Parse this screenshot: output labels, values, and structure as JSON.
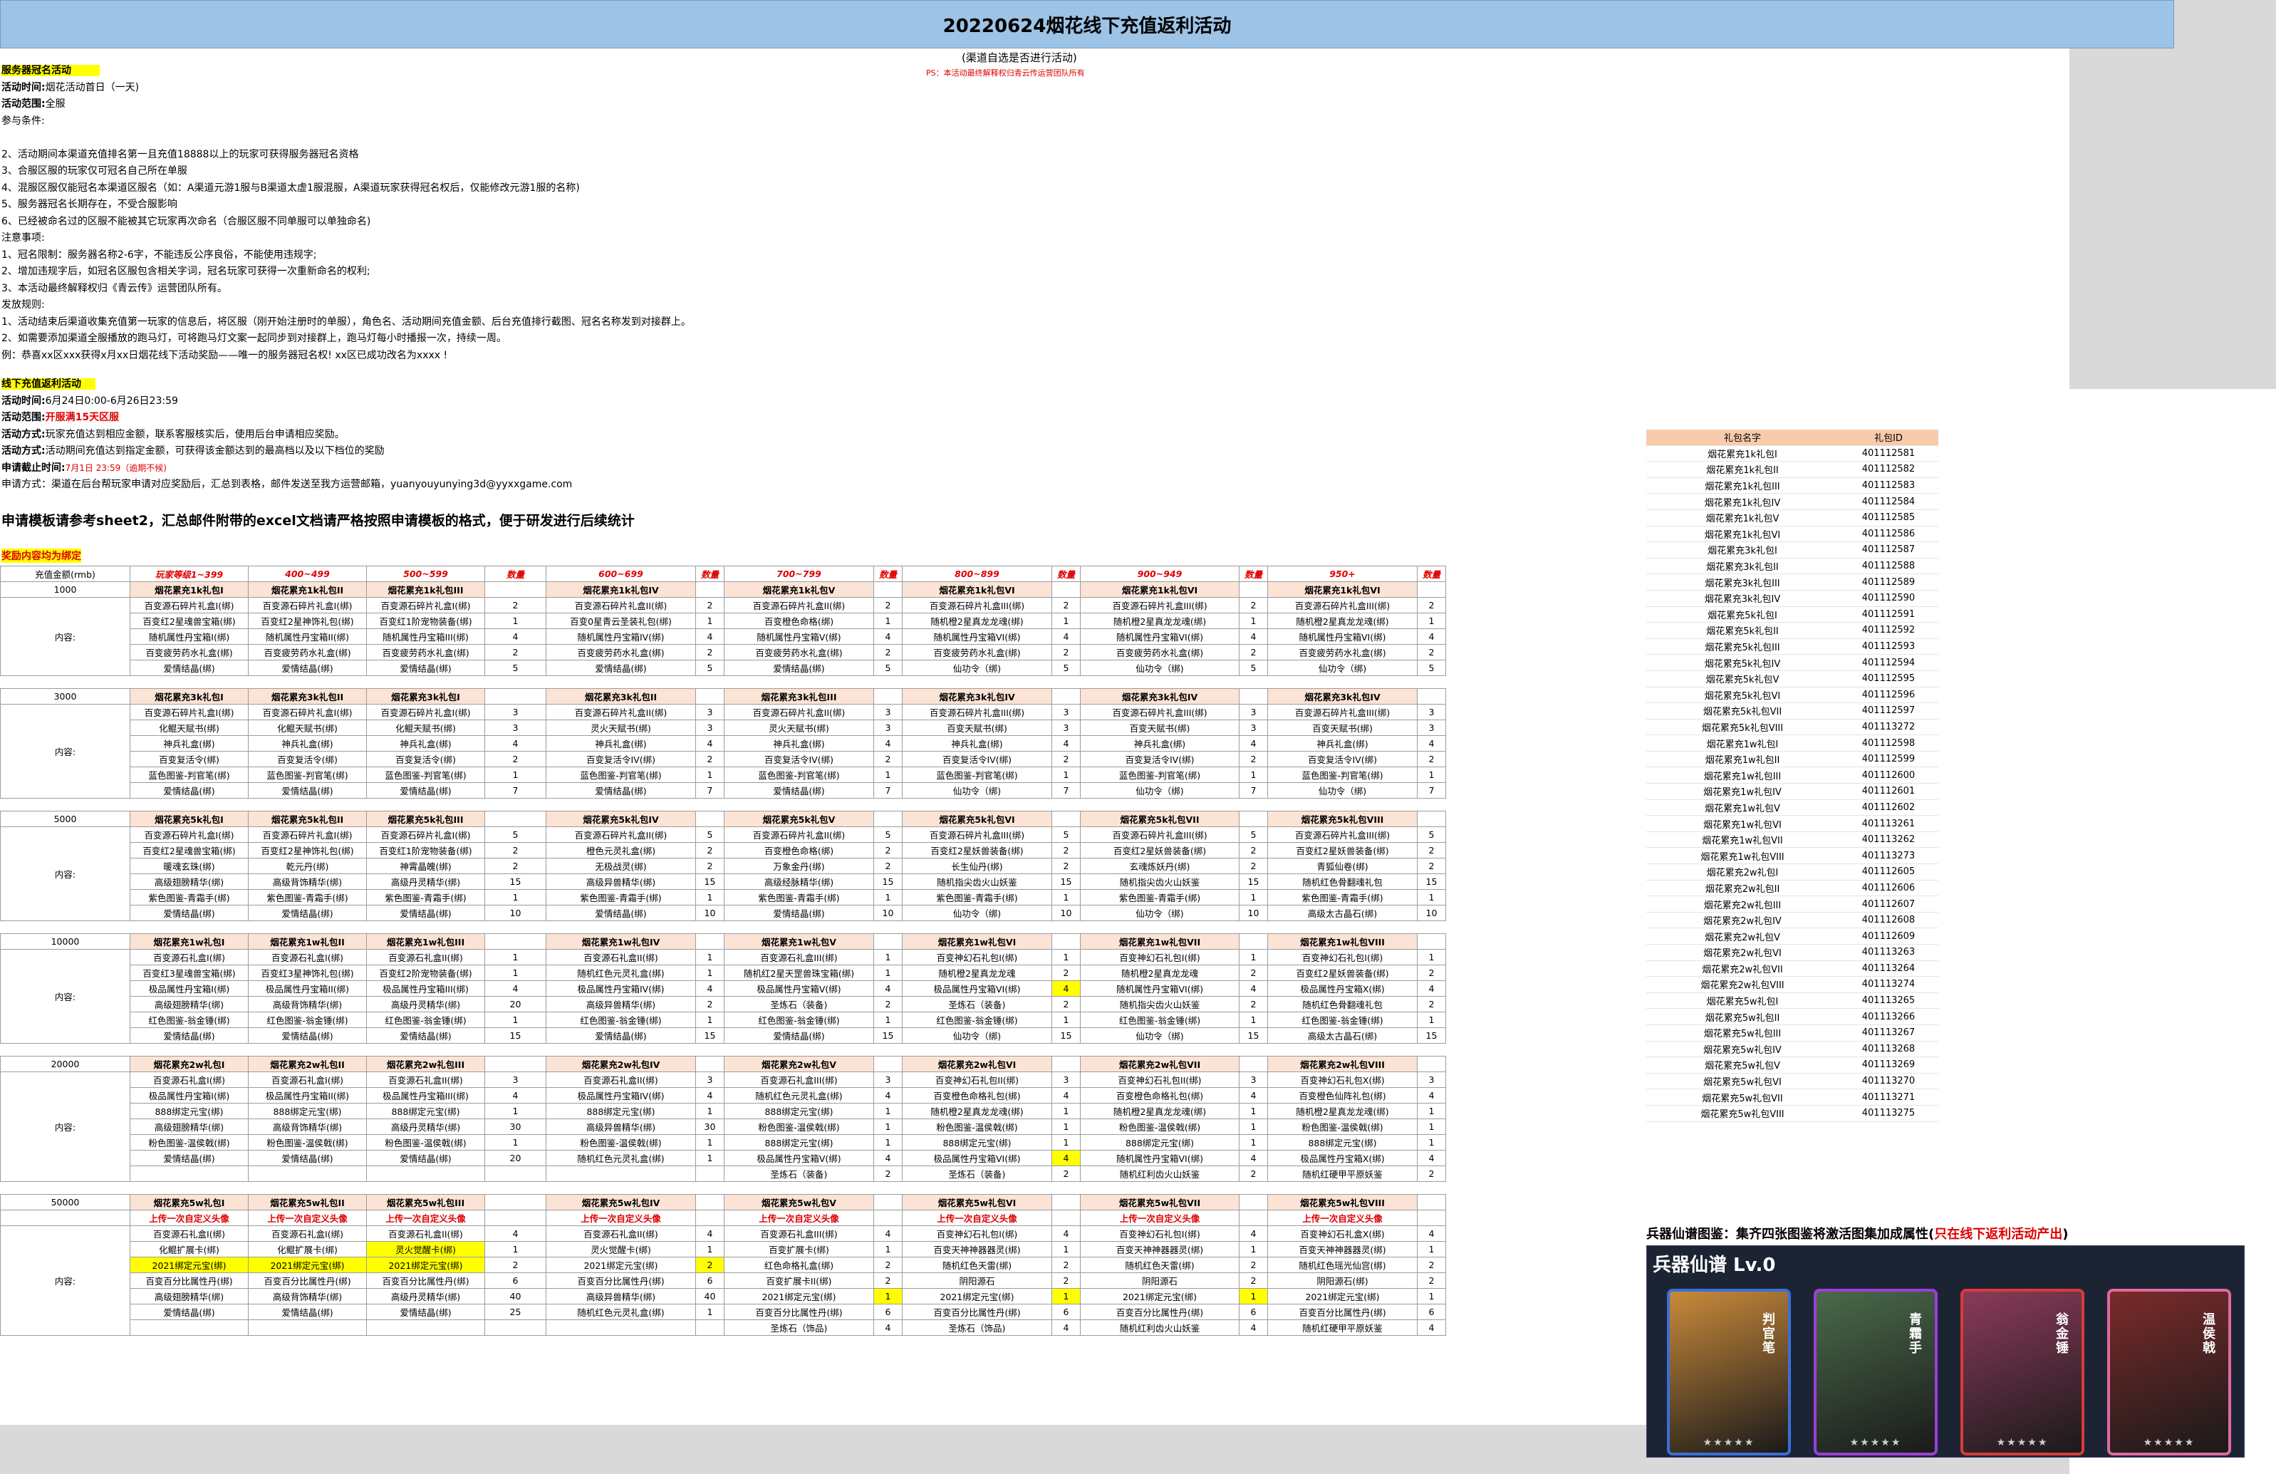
{
  "title": "20220624烟花线下充值返利活动",
  "subtitle": "(渠道自选是否进行活动)",
  "ps_note": "PS：本活动最终解释权归青云传运营团队所有",
  "section1": {
    "heading": "服务器冠名活动",
    "lines": [
      {
        "k": "活动时间:",
        "v": "烟花活动首日（一天)"
      },
      {
        "k": "活动范围:",
        "v": "全服"
      },
      {
        "k": "",
        "v": "参与条件:"
      },
      {
        "k": "",
        "v": ""
      },
      {
        "k": "",
        "v": "2、活动期间本渠道充值排名第一且充值18888以上的玩家可获得服务器冠名资格"
      },
      {
        "k": "",
        "v": "3、合服区服的玩家仅可冠名自己所在单服"
      },
      {
        "k": "",
        "v": "4、混服区服仅能冠名本渠道区服名（如：A渠道元游1服与B渠道太虚1服混服，A渠道玩家获得冠名权后，仅能修改元游1服的名称)"
      },
      {
        "k": "",
        "v": "5、服务器冠名长期存在，不受合服影响"
      },
      {
        "k": "",
        "v": "6、已经被命名过的区服不能被其它玩家再次命名（合服区服不同单服可以单独命名)"
      },
      {
        "k": "",
        "v": "注意事项:"
      },
      {
        "k": "",
        "v": "1、冠名限制：服务器名称2-6字，不能违反公序良俗，不能使用违规字;"
      },
      {
        "k": "",
        "v": "2、增加违规字后，如冠名区服包含相关字词，冠名玩家可获得一次重新命名的权利;"
      },
      {
        "k": "",
        "v": "3、本活动最终解释权归《青云传》运营团队所有。"
      },
      {
        "k": "",
        "v": "发放规则:"
      },
      {
        "k": "",
        "v": "1、活动结束后渠道收集充值第一玩家的信息后，将区服（刚开始注册时的单服），角色名、活动期间充值金额、后台充值排行截图、冠名名称发到对接群上。"
      },
      {
        "k": "",
        "v": "2、如需要添加渠道全服播放的跑马灯，可将跑马灯文案一起同步到对接群上，跑马灯每小时播报一次，持续一周。"
      },
      {
        "k": "",
        "v": "例：恭喜xx区xxx获得x月xx日烟花线下活动奖励——唯一的服务器冠名权! xx区已成功改名为xxxx !"
      }
    ]
  },
  "section2": {
    "heading": "线下充值返利活动",
    "time_k": "活动时间:",
    "time_v": "6月24日0:00-6月26日23:59",
    "range_k": "活动范围:",
    "range_v": "开服满15天区服",
    "way_k": "活动方式:",
    "way_v": "玩家充值达到相应金额，联系客服核实后，使用后台申请相应奖励。",
    "rule_k": "活动方式:",
    "rule_v": "活动期间充值达到指定金额，可获得该金额达到的最高档以及以下档位的奖励",
    "deadline_k": "申请截止时间:",
    "deadline_v": "7月1日 23:59（逾期不候)",
    "apply": "申请方式：渠道在后台帮玩家申请对应奖励后，汇总到表格，邮件发送至我方运营邮箱，yuanyouyunying3d@yyxxgame.com"
  },
  "big_note": "申请模板请参考sheet2，汇总邮件附带的excel文档请严格按照申请模板的格式，便于研发进行后续统计",
  "reward_tag": "奖励内容均为绑定",
  "table_header": [
    "充值金额(rmb)",
    "玩家等级1~399",
    "400~499",
    "500~599",
    "数量",
    "600~699",
    "数量",
    "700~799",
    "数量",
    "800~899",
    "数量",
    "900~949",
    "数量",
    "950+",
    "数量"
  ],
  "content_label": "内容:",
  "tiers": [
    {
      "amount": "1000",
      "heads": [
        "烟花累充1k礼包I",
        "烟花累充1k礼包II",
        "烟花累充1k礼包III",
        "烟花累充1k礼包IV",
        "烟花累充1k礼包V",
        "烟花累充1k礼包VI",
        "烟花累充1k礼包VI",
        "烟花累充1k礼包VI"
      ],
      "rows": [
        [
          "百变源石碎片礼盒I(绑)",
          "百变源石碎片礼盒I(绑)",
          "百变源石碎片礼盒I(绑)",
          "2",
          "百变源石碎片礼盒II(绑)",
          "2",
          "百变源石碎片礼盒II(绑)",
          "2",
          "百变源石碎片礼盒III(绑)",
          "2",
          "百变源石碎片礼盒III(绑)",
          "2",
          "百变源石碎片礼盒III(绑)",
          "2"
        ],
        [
          "百变红2星魂兽宝箱(绑)",
          "百变红2星神饰礼包(绑)",
          "百变红1阶宠物装备(绑)",
          "1",
          "百变0星青云圣装礼包(绑)",
          "1",
          "百变橙色命格(绑)",
          "1",
          "随机橙2星真龙龙魂(绑)",
          "1",
          "随机橙2星真龙龙魂(绑)",
          "1",
          "随机橙2星真龙龙魂(绑)",
          "1"
        ],
        [
          "随机属性丹宝箱I(绑)",
          "随机属性丹宝箱II(绑)",
          "随机属性丹宝箱III(绑)",
          "4",
          "随机属性丹宝箱IV(绑)",
          "4",
          "随机属性丹宝箱V(绑)",
          "4",
          "随机属性丹宝箱VI(绑)",
          "4",
          "随机属性丹宝箱VI(绑)",
          "4",
          "随机属性丹宝箱VI(绑)",
          "4"
        ],
        [
          "百变疲劳药水礼盒(绑)",
          "百变疲劳药水礼盒(绑)",
          "百变疲劳药水礼盒(绑)",
          "2",
          "百变疲劳药水礼盒(绑)",
          "2",
          "百变疲劳药水礼盒(绑)",
          "2",
          "百变疲劳药水礼盒(绑)",
          "2",
          "百变疲劳药水礼盒(绑)",
          "2",
          "百变疲劳药水礼盒(绑)",
          "2"
        ],
        [
          "爱情结晶(绑)",
          "爱情结晶(绑)",
          "爱情结晶(绑)",
          "5",
          "爱情结晶(绑)",
          "5",
          "爱情结晶(绑)",
          "5",
          "仙功令（绑)",
          "5",
          "仙功令（绑)",
          "5",
          "仙功令（绑)",
          "5"
        ]
      ]
    },
    {
      "amount": "3000",
      "heads": [
        "烟花累充3k礼包I",
        "烟花累充3k礼包II",
        "烟花累充3k礼包I",
        "烟花累充3k礼包II",
        "烟花累充3k礼包III",
        "烟花累充3k礼包IV",
        "烟花累充3k礼包IV",
        "烟花累充3k礼包IV"
      ],
      "rows": [
        [
          "百变源石碎片礼盒I(绑)",
          "百变源石碎片礼盒I(绑)",
          "百变源石碎片礼盒I(绑)",
          "3",
          "百变源石碎片礼盒II(绑)",
          "3",
          "百变源石碎片礼盒II(绑)",
          "3",
          "百变源石碎片礼盒III(绑)",
          "3",
          "百变源石碎片礼盒III(绑)",
          "3",
          "百变源石碎片礼盒III(绑)",
          "3"
        ],
        [
          "化鲲天赋书(绑)",
          "化鲲天赋书(绑)",
          "化鲲天赋书(绑)",
          "3",
          "灵火天赋书(绑)",
          "3",
          "灵火天赋书(绑)",
          "3",
          "百变天赋书(绑)",
          "3",
          "百变天赋书(绑)",
          "3",
          "百变天赋书(绑)",
          "3"
        ],
        [
          "神兵礼盒(绑)",
          "神兵礼盒(绑)",
          "神兵礼盒(绑)",
          "4",
          "神兵礼盒(绑)",
          "4",
          "神兵礼盒(绑)",
          "4",
          "神兵礼盒(绑)",
          "4",
          "神兵礼盒(绑)",
          "4",
          "神兵礼盒(绑)",
          "4"
        ],
        [
          "百变复活令(绑)",
          "百变复活令(绑)",
          "百变复活令(绑)",
          "2",
          "百变复活令IV(绑)",
          "2",
          "百变复活令IV(绑)",
          "2",
          "百变复活令IV(绑)",
          "2",
          "百变复活令IV(绑)",
          "2",
          "百变复活令IV(绑)",
          "2"
        ],
        [
          "蓝色图鉴-判官笔(绑)",
          "蓝色图鉴-判官笔(绑)",
          "蓝色图鉴-判官笔(绑)",
          "1",
          "蓝色图鉴-判官笔(绑)",
          "1",
          "蓝色图鉴-判官笔(绑)",
          "1",
          "蓝色图鉴-判官笔(绑)",
          "1",
          "蓝色图鉴-判官笔(绑)",
          "1",
          "蓝色图鉴-判官笔(绑)",
          "1"
        ],
        [
          "爱情结晶(绑)",
          "爱情结晶(绑)",
          "爱情结晶(绑)",
          "7",
          "爱情结晶(绑)",
          "7",
          "爱情结晶(绑)",
          "7",
          "仙功令（绑)",
          "7",
          "仙功令（绑)",
          "7",
          "仙功令（绑)",
          "7"
        ]
      ]
    },
    {
      "amount": "5000",
      "heads": [
        "烟花累充5k礼包I",
        "烟花累充5k礼包II",
        "烟花累充5k礼包III",
        "烟花累充5k礼包IV",
        "烟花累充5k礼包V",
        "烟花累充5k礼包VI",
        "烟花累充5k礼包VII",
        "烟花累充5k礼包VIII"
      ],
      "rows": [
        [
          "百变源石碎片礼盒I(绑)",
          "百变源石碎片礼盒I(绑)",
          "百变源石碎片礼盒I(绑)",
          "5",
          "百变源石碎片礼盒II(绑)",
          "5",
          "百变源石碎片礼盒II(绑)",
          "5",
          "百变源石碎片礼盒III(绑)",
          "5",
          "百变源石碎片礼盒III(绑)",
          "5",
          "百变源石碎片礼盒III(绑)",
          "5"
        ],
        [
          "百变红2星魂兽宝箱(绑)",
          "百变红2星神饰礼包(绑)",
          "百变红1阶宠物装备(绑)",
          "2",
          "橙色元灵礼盒(绑)",
          "2",
          "百变橙色命格(绑)",
          "2",
          "百变红2星妖兽装备(绑)",
          "2",
          "百变红2星妖兽装备(绑)",
          "2",
          "百变红2星妖兽装备(绑)",
          "2"
        ],
        [
          "暖魂玄珠(绑)",
          "乾元丹(绑)",
          "神霄晶魄(绑)",
          "2",
          "无极战灵(绑)",
          "2",
          "万象金丹(绑)",
          "2",
          "长生仙丹(绑)",
          "2",
          "玄魂炼妖丹(绑)",
          "2",
          "青狐仙卷(绑)",
          "2"
        ],
        [
          "高级翅膀精华(绑)",
          "高级背饰精华(绑)",
          "高级丹灵精华(绑)",
          "15",
          "高级异兽精华(绑)",
          "15",
          "高级经脉精华(绑)",
          "15",
          "随机指尖齿火山妖鉴",
          "15",
          "随机指尖齿火山妖鉴",
          "15",
          "随机红色骨翻魂礼包",
          "15"
        ],
        [
          "紫色图鉴-青霜手(绑)",
          "紫色图鉴-青霜手(绑)",
          "紫色图鉴-青霜手(绑)",
          "1",
          "紫色图鉴-青霜手(绑)",
          "1",
          "紫色图鉴-青霜手(绑)",
          "1",
          "紫色图鉴-青霜手(绑)",
          "1",
          "紫色图鉴-青霜手(绑)",
          "1",
          "紫色图鉴-青霜手(绑)",
          "1"
        ],
        [
          "爱情结晶(绑)",
          "爱情结晶(绑)",
          "爱情结晶(绑)",
          "10",
          "爱情结晶(绑)",
          "10",
          "爱情结晶(绑)",
          "10",
          "仙功令（绑)",
          "10",
          "仙功令（绑)",
          "10",
          "高级太古晶石(绑)",
          "10"
        ]
      ]
    },
    {
      "amount": "10000",
      "heads": [
        "烟花累充1w礼包I",
        "烟花累充1w礼包II",
        "烟花累充1w礼包III",
        "烟花累充1w礼包IV",
        "烟花累充1w礼包V",
        "烟花累充1w礼包VI",
        "烟花累充1w礼包VII",
        "烟花累充1w礼包VIII"
      ],
      "rows": [
        [
          "百变源石礼盒I(绑)",
          "百变源石礼盒I(绑)",
          "百变源石礼盒II(绑)",
          "1",
          "百变源石礼盒II(绑)",
          "1",
          "百变源石礼盒III(绑)",
          "1",
          "百变神幻石礼包I(绑)",
          "1",
          "百变神幻石礼包I(绑)",
          "1",
          "百变神幻石礼包I(绑)",
          "1"
        ],
        [
          "百变红3星魂兽宝箱(绑)",
          "百变红3星神饰礼包(绑)",
          "百变红2阶宠物装备(绑)",
          "1",
          "随机红色元灵礼盒(绑)",
          "1",
          "随机红2星天罡兽珠宝箱(绑)",
          "1",
          "随机橙2星真龙龙魂",
          "2",
          "随机橙2星真龙龙魂",
          "2",
          "百变红2星妖兽装备(绑)",
          "2"
        ],
        [
          "极品属性丹宝箱I(绑)",
          "极品属性丹宝箱II(绑)",
          "极品属性丹宝箱III(绑)",
          "4",
          "极品属性丹宝箱IV(绑)",
          "4",
          "极品属性丹宝箱V(绑)",
          "4",
          "极品属性丹宝箱VI(绑)",
          "4",
          "随机属性丹宝箱VI(绑)",
          "4",
          "极品属性丹宝箱X(绑)",
          "4"
        ],
        [
          "高级翅膀精华(绑)",
          "高级背饰精华(绑)",
          "高级丹灵精华(绑)",
          "20",
          "高级异兽精华(绑)",
          "2",
          "圣炼石（装备)",
          "2",
          "圣炼石（装备)",
          "2",
          "随机指尖齿火山妖鉴",
          "2",
          "随机红色骨翻魂礼包",
          "2"
        ],
        [
          "红色图鉴-翁金锤(绑)",
          "红色图鉴-翁金锤(绑)",
          "红色图鉴-翁金锤(绑)",
          "1",
          "红色图鉴-翁金锤(绑)",
          "1",
          "红色图鉴-翁金锤(绑)",
          "1",
          "红色图鉴-翁金锤(绑)",
          "1",
          "红色图鉴-翁金锤(绑)",
          "1",
          "红色图鉴-翁金锤(绑)",
          "1"
        ],
        [
          "爱情结晶(绑)",
          "爱情结晶(绑)",
          "爱情结晶(绑)",
          "15",
          "爱情结晶(绑)",
          "15",
          "爱情结晶(绑)",
          "15",
          "仙功令（绑)",
          "15",
          "仙功令（绑)",
          "15",
          "高级太古晶石(绑)",
          "15"
        ]
      ]
    },
    {
      "amount": "20000",
      "heads": [
        "烟花累充2w礼包I",
        "烟花累充2w礼包II",
        "烟花累充2w礼包III",
        "烟花累充2w礼包IV",
        "烟花累充2w礼包V",
        "烟花累充2w礼包VI",
        "烟花累充2w礼包VII",
        "烟花累充2w礼包VIII"
      ],
      "rows": [
        [
          "百变源石礼盒I(绑)",
          "百变源石礼盒I(绑)",
          "百变源石礼盒II(绑)",
          "3",
          "百变源石礼盒II(绑)",
          "3",
          "百变源石礼盒III(绑)",
          "3",
          "百变神幻石礼包II(绑)",
          "3",
          "百变神幻石礼包II(绑)",
          "3",
          "百变神幻石礼包X(绑)",
          "3"
        ],
        [
          "极品属性丹宝箱I(绑)",
          "极品属性丹宝箱II(绑)",
          "极品属性丹宝箱III(绑)",
          "4",
          "极品属性丹宝箱IV(绑)",
          "4",
          "随机红色元灵礼盒(绑)",
          "4",
          "百变橙色命格礼包(绑)",
          "4",
          "百变橙色命格礼包(绑)",
          "4",
          "百变橙色仙阵礼包(绑)",
          "4"
        ],
        [
          "888绑定元宝(绑)",
          "888绑定元宝(绑)",
          "888绑定元宝(绑)",
          "1",
          "888绑定元宝(绑)",
          "1",
          "888绑定元宝(绑)",
          "1",
          "随机橙2星真龙龙魂(绑)",
          "1",
          "随机橙2星真龙龙魂(绑)",
          "1",
          "随机橙2星真龙龙魂(绑)",
          "1"
        ],
        [
          "高级翅膀精华(绑)",
          "高级背饰精华(绑)",
          "高级丹灵精华(绑)",
          "30",
          "高级异兽精华(绑)",
          "30",
          "粉色图鉴-温侯戟(绑)",
          "1",
          "粉色图鉴-温侯戟(绑)",
          "1",
          "粉色图鉴-温侯戟(绑)",
          "1",
          "粉色图鉴-温侯戟(绑)",
          "1"
        ],
        [
          "粉色图鉴-温侯戟(绑)",
          "粉色图鉴-温侯戟(绑)",
          "粉色图鉴-温侯戟(绑)",
          "1",
          "粉色图鉴-温侯戟(绑)",
          "1",
          "888绑定元宝(绑)",
          "1",
          "888绑定元宝(绑)",
          "1",
          "888绑定元宝(绑)",
          "1",
          "888绑定元宝(绑)",
          "1"
        ],
        [
          "爱情结晶(绑)",
          "爱情结晶(绑)",
          "爱情结晶(绑)",
          "20",
          "随机红色元灵礼盒(绑)",
          "1",
          "极品属性丹宝箱V(绑)",
          "4",
          "极品属性丹宝箱VI(绑)",
          "4",
          "随机属性丹宝箱VI(绑)",
          "4",
          "极品属性丹宝箱X(绑)",
          "4"
        ],
        [
          "",
          "",
          "",
          "",
          "",
          "",
          "圣炼石（装备)",
          "2",
          "圣炼石（装备)",
          "2",
          "随机红利齿火山妖鉴",
          "2",
          "随机红硬甲平原妖鉴",
          "2"
        ]
      ]
    },
    {
      "amount": "50000",
      "heads": [
        "烟花累充5w礼包I",
        "烟花累充5w礼包II",
        "烟花累充5w礼包III",
        "烟花累充5w礼包IV",
        "烟花累充5w礼包V",
        "烟花累充5w礼包VI",
        "烟花累充5w礼包VII",
        "烟花累充5w礼包VIII"
      ],
      "upload": "上传一次自定义头像",
      "rows": [
        [
          "百变源石礼盒I(绑)",
          "百变源石礼盒I(绑)",
          "百变源石礼盒II(绑)",
          "4",
          "百变源石礼盒II(绑)",
          "4",
          "百变源石礼盒III(绑)",
          "4",
          "百变神幻石礼包I(绑)",
          "4",
          "百变神幻石礼包I(绑)",
          "4",
          "百变神幻石礼盒X(绑)",
          "4"
        ],
        [
          "化鲲扩展卡(绑)",
          "化鲲扩展卡(绑)",
          "灵火觉醒卡(绑)",
          "1",
          "灵火觉醒卡(绑)",
          "1",
          "百变扩展卡(绑)",
          "1",
          "百变天神神器器灵(绑)",
          "1",
          "百变天神神器器灵(绑)",
          "1",
          "百变天神神器器灵(绑)",
          "1"
        ],
        [
          "2021绑定元宝(绑)",
          "2021绑定元宝(绑)",
          "2021绑定元宝(绑)",
          "2",
          "2021绑定元宝(绑)",
          "2",
          "红色命格礼盒(绑)",
          "2",
          "随机红色天雷(绑)",
          "2",
          "随机红色天雷(绑)",
          "2",
          "随机红色瑶光仙宫(绑)",
          "2"
        ],
        [
          "百变百分比属性丹(绑)",
          "百变百分比属性丹(绑)",
          "百变百分比属性丹(绑)",
          "6",
          "百变百分比属性丹(绑)",
          "6",
          "百变扩展卡II(绑)",
          "2",
          "阴阳源石",
          "2",
          "阴阳源石",
          "2",
          "阴阳源石(绑)",
          "2"
        ],
        [
          "高级翅膀精华(绑)",
          "高级背饰精华(绑)",
          "高级丹灵精华(绑)",
          "40",
          "高级异兽精华(绑)",
          "40",
          "2021绑定元宝(绑)",
          "1",
          "2021绑定元宝(绑)",
          "1",
          "2021绑定元宝(绑)",
          "1",
          "2021绑定元宝(绑)",
          "1"
        ],
        [
          "爱情结晶(绑)",
          "爱情结晶(绑)",
          "爱情结晶(绑)",
          "25",
          "随机红色元灵礼盒(绑)",
          "1",
          "百变百分比属性丹(绑)",
          "6",
          "百变百分比属性丹(绑)",
          "6",
          "百变百分比属性丹(绑)",
          "6",
          "百变百分比属性丹(绑)",
          "6"
        ],
        [
          "",
          "",
          "",
          "",
          "",
          "",
          "圣炼石（饰品)",
          "4",
          "圣炼石（饰品)",
          "4",
          "随机红利齿火山妖鉴",
          "4",
          "随机红硬甲平原妖鉴",
          "4"
        ]
      ]
    }
  ],
  "gift_ids": {
    "headers": [
      "礼包名字",
      "礼包ID"
    ],
    "rows": [
      [
        "烟花累充1k礼包I",
        "401112581"
      ],
      [
        "烟花累充1k礼包II",
        "401112582"
      ],
      [
        "烟花累充1k礼包III",
        "401112583"
      ],
      [
        "烟花累充1k礼包IV",
        "401112584"
      ],
      [
        "烟花累充1k礼包V",
        "401112585"
      ],
      [
        "烟花累充1k礼包VI",
        "401112586"
      ],
      [
        "烟花累充3k礼包I",
        "401112587"
      ],
      [
        "烟花累充3k礼包II",
        "401112588"
      ],
      [
        "烟花累充3k礼包III",
        "401112589"
      ],
      [
        "烟花累充3k礼包IV",
        "401112590"
      ],
      [
        "烟花累充5k礼包I",
        "401112591"
      ],
      [
        "烟花累充5k礼包II",
        "401112592"
      ],
      [
        "烟花累充5k礼包III",
        "401112593"
      ],
      [
        "烟花累充5k礼包IV",
        "401112594"
      ],
      [
        "烟花累充5k礼包V",
        "401112595"
      ],
      [
        "烟花累充5k礼包VI",
        "401112596"
      ],
      [
        "烟花累充5k礼包VII",
        "401112597"
      ],
      [
        "烟花累充5k礼包VIII",
        "401113272"
      ],
      [
        "烟花累充1w礼包I",
        "401112598"
      ],
      [
        "烟花累充1w礼包II",
        "401112599"
      ],
      [
        "烟花累充1w礼包III",
        "401112600"
      ],
      [
        "烟花累充1w礼包IV",
        "401112601"
      ],
      [
        "烟花累充1w礼包V",
        "401112602"
      ],
      [
        "烟花累充1w礼包VI",
        "401113261"
      ],
      [
        "烟花累充1w礼包VII",
        "401113262"
      ],
      [
        "烟花累充1w礼包VIII",
        "401113273"
      ],
      [
        "烟花累充2w礼包I",
        "401112605"
      ],
      [
        "烟花累充2w礼包II",
        "401112606"
      ],
      [
        "烟花累充2w礼包III",
        "401112607"
      ],
      [
        "烟花累充2w礼包IV",
        "401112608"
      ],
      [
        "烟花累充2w礼包V",
        "401112609"
      ],
      [
        "烟花累充2w礼包VI",
        "401113263"
      ],
      [
        "烟花累充2w礼包VII",
        "401113264"
      ],
      [
        "烟花累充2w礼包VIII",
        "401113274"
      ],
      [
        "烟花累充5w礼包I",
        "401113265"
      ],
      [
        "烟花累充5w礼包II",
        "401113266"
      ],
      [
        "烟花累充5w礼包III",
        "401113267"
      ],
      [
        "烟花累充5w礼包IV",
        "401113268"
      ],
      [
        "烟花累充5w礼包V",
        "401113269"
      ],
      [
        "烟花累充5w礼包VI",
        "401113270"
      ],
      [
        "烟花累充5w礼包VII",
        "401113271"
      ],
      [
        "烟花累充5w礼包VIII",
        "401113275"
      ]
    ]
  },
  "weapon": {
    "title_black": "兵器仙谱图鉴：集齐四张图鉴将激活图集加成属性(",
    "title_red": "只在线下返利活动产出",
    "title_end": ")",
    "panel_title": "兵器仙谱    Lv.0",
    "cards": [
      {
        "name": "判官笔",
        "color": "#3b6fd8",
        "bg": "#c98a3a"
      },
      {
        "name": "青霜手",
        "color": "#9b3fd8",
        "bg": "#4a6a4a"
      },
      {
        "name": "翁金锤",
        "color": "#d83b3b",
        "bg": "#8a3a5a"
      },
      {
        "name": "温侯戟",
        "color": "#e06aa0",
        "bg": "#7a2a2a"
      }
    ],
    "stars": "★★★★★"
  }
}
